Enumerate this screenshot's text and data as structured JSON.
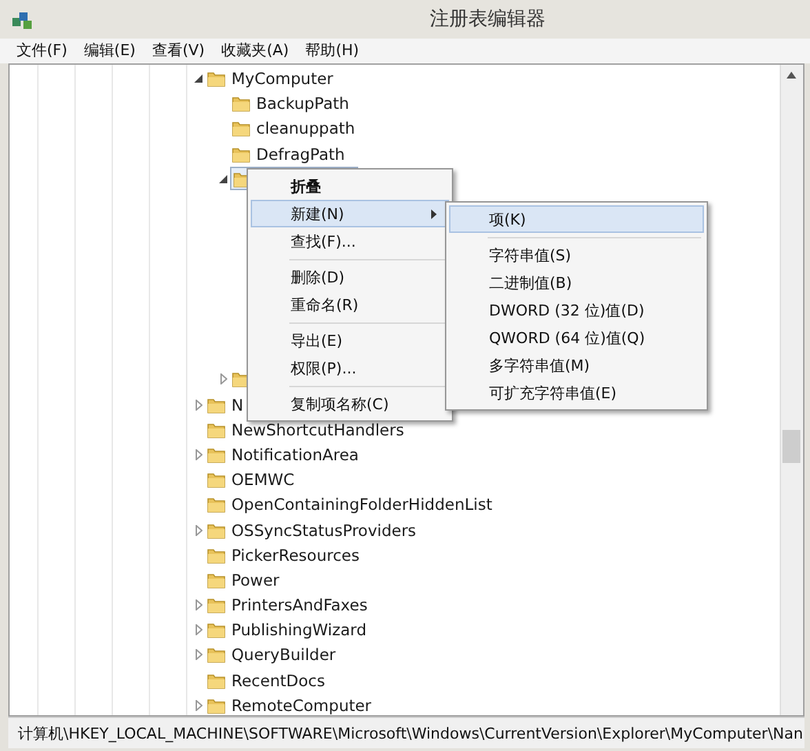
{
  "window": {
    "title": "注册表编辑器"
  },
  "menu_bar": [
    {
      "label": "文件(F)"
    },
    {
      "label": "编辑(E)"
    },
    {
      "label": "查看(V)"
    },
    {
      "label": "收藏夹(A)"
    },
    {
      "label": "帮助(H)"
    }
  ],
  "tree": [
    {
      "label": "MyComputer",
      "expanded": true,
      "children": [
        {
          "label": "BackupPath"
        },
        {
          "label": "cleanuppath"
        },
        {
          "label": "DefragPath"
        },
        {
          "selected": true,
          "expanded": true
        },
        {
          "expanded": false
        }
      ]
    },
    {
      "label": "N",
      "expanded": false
    },
    {
      "label": "NewShortcutHandlers"
    },
    {
      "label": "NotificationArea",
      "expanded": false
    },
    {
      "label": "OEMWC"
    },
    {
      "label": "OpenContainingFolderHiddenList"
    },
    {
      "label": "OSSyncStatusProviders",
      "expanded": false
    },
    {
      "label": "PickerResources"
    },
    {
      "label": "Power"
    },
    {
      "label": "PrintersAndFaxes",
      "expanded": false
    },
    {
      "label": "PublishingWizard",
      "expanded": false
    },
    {
      "label": "QueryBuilder",
      "expanded": false
    },
    {
      "label": "RecentDocs"
    },
    {
      "label": "RemoteComputer",
      "expanded": false
    }
  ],
  "context_menu": {
    "items": [
      {
        "kind": "item",
        "label": "折叠",
        "default": true,
        "selected": false,
        "submenu": false
      },
      {
        "kind": "item",
        "label": "新建(N)",
        "default": false,
        "selected": true,
        "submenu": true
      },
      {
        "kind": "item",
        "label": "查找(F)...",
        "selected": false
      },
      {
        "kind": "separator"
      },
      {
        "kind": "item",
        "label": "删除(D)",
        "selected": false
      },
      {
        "kind": "item",
        "label": "重命名(R)",
        "selected": false
      },
      {
        "kind": "separator"
      },
      {
        "kind": "item",
        "label": "导出(E)",
        "selected": false
      },
      {
        "kind": "item",
        "label": "权限(P)...",
        "selected": false
      },
      {
        "kind": "separator"
      },
      {
        "kind": "item",
        "label": "复制项名称(C)",
        "selected": false
      }
    ]
  },
  "submenu": {
    "items": [
      {
        "kind": "item",
        "label": "项(K)",
        "selected": true
      },
      {
        "kind": "separator"
      },
      {
        "kind": "item",
        "label": "字符串值(S)",
        "selected": false
      },
      {
        "kind": "item",
        "label": "二进制值(B)",
        "selected": false
      },
      {
        "kind": "item",
        "label": "DWORD (32 位)值(D)",
        "selected": false
      },
      {
        "kind": "item",
        "label": "QWORD (64 位)值(Q)",
        "selected": false
      },
      {
        "kind": "item",
        "label": "多字符串值(M)",
        "selected": false
      },
      {
        "kind": "item",
        "label": "可扩充字符串值(E)",
        "selected": false
      }
    ]
  },
  "status_bar": {
    "path": "计算机\\HKEY_LOCAL_MACHINE\\SOFTWARE\\Microsoft\\Windows\\CurrentVersion\\Explorer\\MyComputer\\Nan"
  }
}
